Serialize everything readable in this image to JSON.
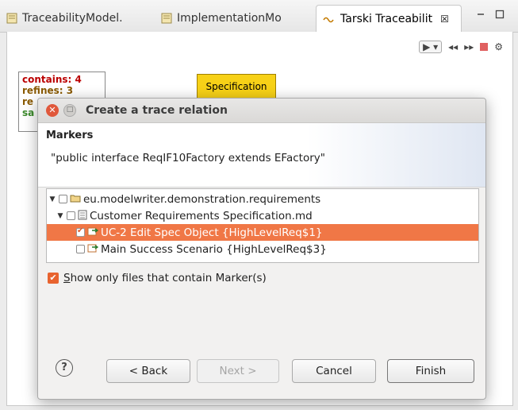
{
  "tabs": [
    {
      "label": "TraceabilityModel."
    },
    {
      "label": "ImplementationMo"
    },
    {
      "label": "Tarski Traceabilit",
      "close": "☒"
    }
  ],
  "canvas": {
    "node_left": {
      "contains": "contains: 4",
      "refines": "refines: 3",
      "re": "re",
      "sa": "sa"
    },
    "node_spec": "Specification"
  },
  "dialog": {
    "title": "Create a trace relation",
    "section_heading": "Markers",
    "marker_text": "\"public interface ReqIF10Factory extends EFactory\"",
    "tree": [
      {
        "label": "eu.modelwriter.demonstration.requirements",
        "checked": false
      },
      {
        "label": "Customer Requirements Specification.md",
        "checked": false
      },
      {
        "label": "UC-2 Edit Spec Object {HighLevelReq$1}",
        "checked": true
      },
      {
        "label": "Main Success Scenario {HighLevelReq$3}",
        "checked": false
      }
    ],
    "show_only_label": "how only files that contain Marker(s)",
    "show_only_mnemonic": "S",
    "buttons": {
      "back": "< Back",
      "next": "Next >",
      "cancel": "Cancel",
      "finish": "Finish"
    },
    "colors": {
      "selection": "#f07746",
      "accent": "#e8632f"
    }
  }
}
